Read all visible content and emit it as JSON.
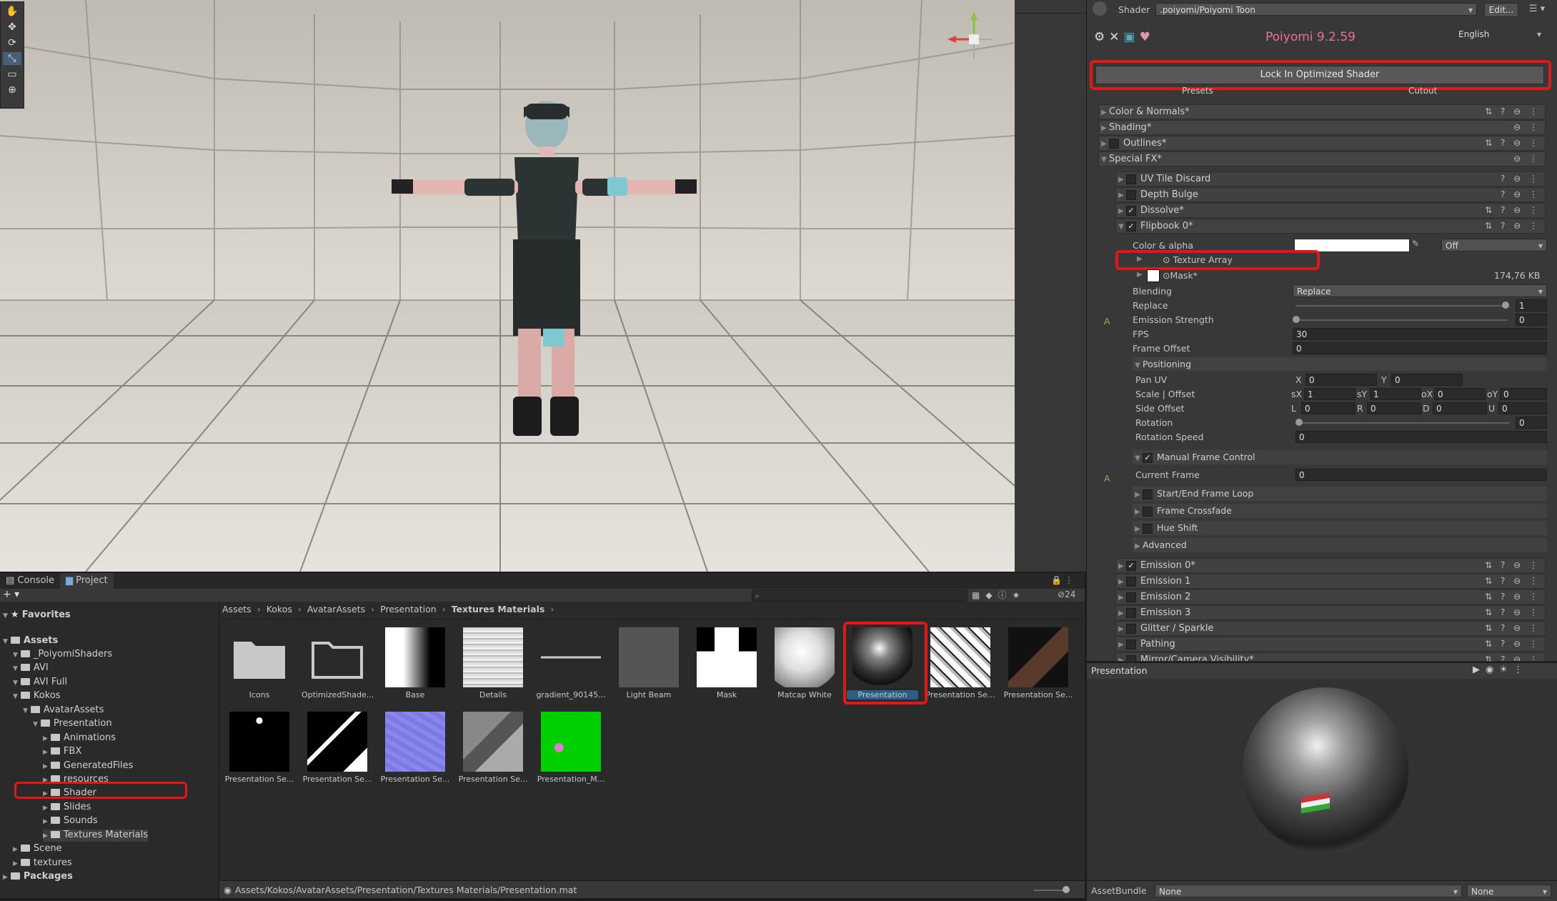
{
  "scene": {
    "tools": [
      "hand-tool",
      "move-tool",
      "rotate-tool",
      "scale-tool",
      "rect-tool",
      "transform-tool"
    ],
    "gizmo_labels": {
      "y": "y",
      "x": "x"
    }
  },
  "inspector": {
    "shader_label": "Shader",
    "shader_value": ".poiyomi/Poiyomi Toon",
    "edit_button": "Edit...",
    "version_title": "Poiyomi 9.2.59",
    "language": "English",
    "lock_button": "Lock In Optimized Shader",
    "presets_label": "Presets",
    "cutout_label": "Cutout",
    "sections": [
      {
        "label": "Color & Normals*",
        "checkbox": false,
        "has_check": false
      },
      {
        "label": "Shading*",
        "checkbox": false,
        "has_check": false
      },
      {
        "label": "Outlines*",
        "checkbox": false,
        "has_check": true
      },
      {
        "label": "Special FX*",
        "checkbox": false,
        "has_check": false
      }
    ],
    "fx_items": [
      {
        "label": "UV Tile Discard",
        "checked": false
      },
      {
        "label": "Depth Bulge",
        "checked": false
      },
      {
        "label": "Dissolve*",
        "checked": true
      },
      {
        "label": "Flipbook 0*",
        "checked": true
      }
    ],
    "flipbook": {
      "color_alpha_label": "Color & alpha",
      "color_mode": "Off",
      "texture_array": "Texture Array",
      "mask": "Mask*",
      "mask_size": "174,76 KB",
      "blending_label": "Blending",
      "blending_value": "Replace",
      "replace_label": "Replace",
      "replace_value": "1",
      "emission_label": "Emission Strength",
      "emission_value": "0",
      "fps_label": "FPS",
      "fps_value": "30",
      "frame_offset_label": "Frame Offset",
      "frame_offset_value": "0",
      "positioning_label": "Positioning",
      "pan_uv_label": "Pan UV",
      "pan_x": "0",
      "pan_y": "0",
      "scale_offset_label": "Scale | Offset",
      "sx": "1",
      "sy": "1",
      "ox": "0",
      "oy": "0",
      "side_offset_label": "Side Offset",
      "l": "0",
      "r": "0",
      "d": "0",
      "u": "0",
      "rotation_label": "Rotation",
      "rotation_value": "0",
      "rotation_speed_label": "Rotation Speed",
      "rotation_speed_value": "0",
      "manual_frame_label": "Manual Frame Control",
      "current_frame_label": "Current Frame",
      "current_frame_value": "0",
      "start_end_label": "Start/End Frame Loop",
      "crossfade_label": "Frame Crossfade",
      "hue_shift_label": "Hue Shift",
      "advanced_label": "Advanced",
      "axis_labels": {
        "x": "X",
        "y": "Y",
        "sx": "sX",
        "sy": "sY",
        "ox": "oX",
        "oy": "oY",
        "l": "L",
        "r": "R",
        "d": "D",
        "u": "U",
        "a": "A"
      }
    },
    "lower_items": [
      {
        "label": "Emission 0*",
        "checked": true
      },
      {
        "label": "Emission 1",
        "checked": false
      },
      {
        "label": "Emission 2",
        "checked": false
      },
      {
        "label": "Emission 3",
        "checked": false
      },
      {
        "label": "Glitter / Sparkle",
        "checked": false
      },
      {
        "label": "Pathing",
        "checked": false
      },
      {
        "label": "Mirror/Camera Visibility*",
        "checked": false
      }
    ],
    "preview_title": "Presentation",
    "assetbundle_label": "AssetBundle",
    "assetbundle_value": "None",
    "assetbundle_variant": "None"
  },
  "bottom": {
    "tabs": [
      "Console",
      "Project"
    ],
    "badge_count": "24",
    "breadcrumb": [
      "Assets",
      "Kokos",
      "AvatarAssets",
      "Presentation",
      "Textures Materials"
    ],
    "status_path": "Assets/Kokos/AvatarAssets/Presentation/Textures Materials/Presentation.mat",
    "tree": [
      {
        "label": "Favorites",
        "indent": 0,
        "star": true
      },
      {
        "label": "Assets",
        "indent": 0
      },
      {
        "label": "_PoiyomiShaders",
        "indent": 1
      },
      {
        "label": "AVI",
        "indent": 1
      },
      {
        "label": "AVI Full",
        "indent": 1
      },
      {
        "label": "Kokos",
        "indent": 1
      },
      {
        "label": "AvatarAssets",
        "indent": 2
      },
      {
        "label": "Presentation",
        "indent": 3
      },
      {
        "label": "Animations",
        "indent": 4
      },
      {
        "label": "FBX",
        "indent": 4
      },
      {
        "label": "GeneratedFiles",
        "indent": 4
      },
      {
        "label": "resources",
        "indent": 4
      },
      {
        "label": "Shader",
        "indent": 4
      },
      {
        "label": "Slides",
        "indent": 4
      },
      {
        "label": "Sounds",
        "indent": 4
      },
      {
        "label": "Textures Materials",
        "indent": 4
      },
      {
        "label": "Scene",
        "indent": 1
      },
      {
        "label": "textures",
        "indent": 1
      },
      {
        "label": "Packages",
        "indent": 0
      }
    ],
    "assets": [
      {
        "label": "Icons",
        "kind": "folder"
      },
      {
        "label": "OptimizedShade...",
        "kind": "folder"
      },
      {
        "label": "Base",
        "kind": "gradient-bw"
      },
      {
        "label": "Details",
        "kind": "noise"
      },
      {
        "label": "gradient_90145...",
        "kind": "line"
      },
      {
        "label": "Light Beam",
        "kind": "gray"
      },
      {
        "label": "Mask",
        "kind": "mask"
      },
      {
        "label": "Matcap White",
        "kind": "matcap"
      },
      {
        "label": "Presentation",
        "kind": "sphere"
      },
      {
        "label": "Presentation Se...",
        "kind": "white-pattern"
      },
      {
        "label": "Presentation Se...",
        "kind": "dark-pattern"
      },
      {
        "label": "Presentation Se...",
        "kind": "black-dot"
      },
      {
        "label": "Presentation Se...",
        "kind": "black-white"
      },
      {
        "label": "Presentation Se...",
        "kind": "normal"
      },
      {
        "label": "Presentation Se...",
        "kind": "gray-pattern"
      },
      {
        "label": "Presentation_M...",
        "kind": "green"
      }
    ]
  }
}
